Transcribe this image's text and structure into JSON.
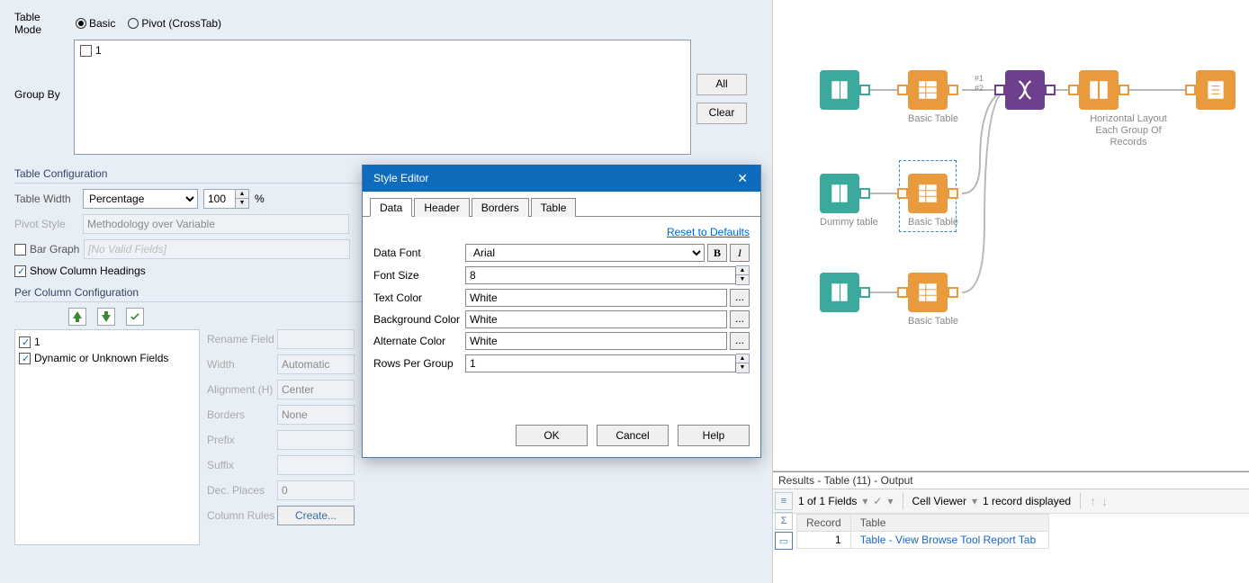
{
  "top": {
    "table_mode_label": "Table Mode",
    "radio_basic": "Basic",
    "radio_pivot": "Pivot (CrossTab)",
    "group_by_label": "Group By",
    "groupby_item": "1",
    "btn_all": "All",
    "btn_clear": "Clear"
  },
  "tablecfg": {
    "header": "Table Configuration",
    "width_label": "Table Width",
    "width_select": "Percentage",
    "width_value": "100",
    "width_pct": "%",
    "pivot_label": "Pivot Style",
    "pivot_value": "Methodology over Variable",
    "bargraph_label": "Bar Graph",
    "bargraph_value": "[No Valid Fields]",
    "show_col_headings": "Show Column Headings"
  },
  "percol": {
    "header": "Per Column Configuration",
    "field_1": "1",
    "field_dynamic": "Dynamic or Unknown Fields",
    "rename": "Rename Field",
    "width_lbl": "Width",
    "width_val": "Automatic",
    "align_lbl": "Alignment (H)",
    "align_val": "Center",
    "borders_lbl": "Borders",
    "borders_val": "None",
    "prefix_lbl": "Prefix",
    "suffix_lbl": "Suffix",
    "dec_lbl": "Dec. Places",
    "dec_val": "0",
    "rules_lbl": "Column Rules",
    "create_btn": "Create..."
  },
  "dialog": {
    "title": "Style Editor",
    "tab_data": "Data",
    "tab_header": "Header",
    "tab_borders": "Borders",
    "tab_table": "Table",
    "reset": "Reset to Defaults",
    "datafont_lbl": "Data Font",
    "datafont_val": "Arial",
    "fontsize_lbl": "Font Size",
    "fontsize_val": "8",
    "textcolor_lbl": "Text Color",
    "textcolor_val": "White",
    "bgcolor_lbl": "Background Color",
    "bgcolor_val": "White",
    "altcolor_lbl": "Alternate Color",
    "altcolor_val": "White",
    "rowsper_lbl": "Rows Per Group",
    "rowsper_val": "1",
    "ok": "OK",
    "cancel": "Cancel",
    "help": "Help",
    "bold": "B",
    "ital": "I",
    "browse": "..."
  },
  "canvas": {
    "hash1": "#1",
    "hash2": "#2",
    "basic_table": "Basic Table",
    "horiz_layout": "Horizontal Layout Each Group Of Records",
    "dummy_table": "Dummy table"
  },
  "results": {
    "header": "Results - Table (11) - Output",
    "fields": "1 of 1 Fields",
    "cellviewer": "Cell Viewer",
    "recdisplayed": "1 record displayed",
    "col_record": "Record",
    "col_table": "Table",
    "row_record": "1",
    "row_table": "Table - View Browse Tool Report Tab"
  }
}
